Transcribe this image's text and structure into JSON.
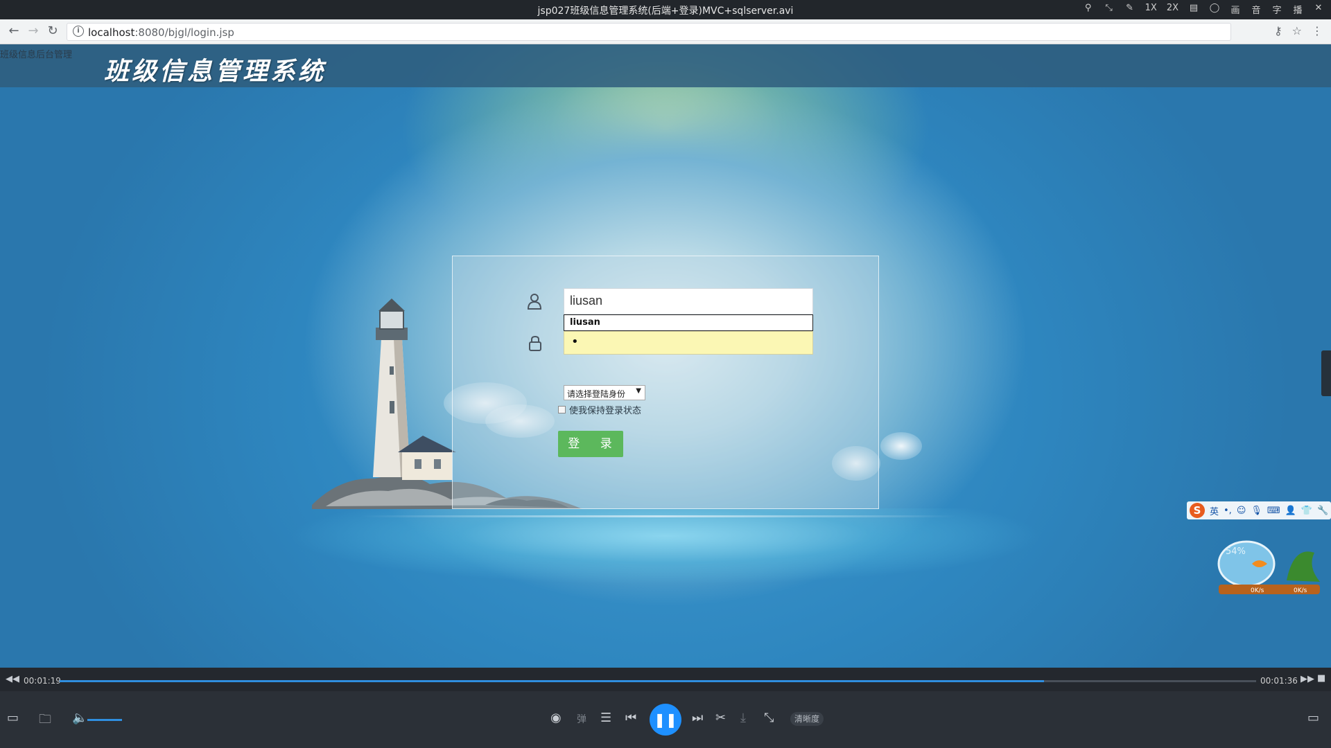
{
  "player_title": "jsp027班级信息管理系统(后端+登录)MVC+sqlserver.avi",
  "player_tools": [
    "1X",
    "2X",
    "画",
    "音",
    "字",
    "播"
  ],
  "browser": {
    "url_host": "localhost",
    "url_rest": ":8080/bjgl/login.jsp"
  },
  "page": {
    "small_label": "班级信息后台管理",
    "logo_text": "班级信息管理系统"
  },
  "login": {
    "username_value": "liusan",
    "autocomplete_item": "liusan",
    "password_mask": "•",
    "role_select_value": "请选择登陆身份",
    "remember_label": "使我保持登录状态",
    "login_button_label": "登 录"
  },
  "ime": {
    "logo": "S",
    "lang": "英"
  },
  "net_widget": {
    "percent": "54%",
    "up": "0K/s",
    "down": "0K/s"
  },
  "player": {
    "current_time": "00:01:19",
    "total_time": "00:01:36",
    "progress": 0.823,
    "volume": 1.0,
    "quality_label": "清晰度",
    "danmaku_label": "弹"
  }
}
